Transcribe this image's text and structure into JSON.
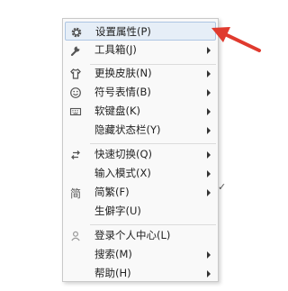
{
  "menu": {
    "items": [
      {
        "label": "设置属性(P)",
        "icon": "gear-icon",
        "submenu": false,
        "highlighted": true
      },
      {
        "label": "工具箱(J)",
        "icon": "wrench-icon",
        "submenu": true
      },
      {
        "label": "更换皮肤(N)",
        "icon": "shirt-icon",
        "submenu": true
      },
      {
        "label": "符号表情(B)",
        "icon": "smiley-icon",
        "submenu": true
      },
      {
        "label": "软键盘(K)",
        "icon": "keyboard-icon",
        "submenu": true
      },
      {
        "label": "隐藏状态栏(Y)",
        "icon": "",
        "submenu": true
      },
      {
        "label": "快速切换(Q)",
        "icon": "switch-arrows-icon",
        "submenu": true
      },
      {
        "label": "输入模式(X)",
        "icon": "",
        "submenu": true
      },
      {
        "label": "简繁(F)",
        "icon": "simplified-chinese-icon",
        "icon_text": "简",
        "submenu": true
      },
      {
        "label": "生僻字(U)",
        "icon": "",
        "submenu": false
      },
      {
        "label": "登录个人中心(L)",
        "icon": "user-icon",
        "submenu": false
      },
      {
        "label": "搜索(M)",
        "icon": "",
        "submenu": true
      },
      {
        "label": "帮助(H)",
        "icon": "",
        "submenu": true
      }
    ]
  },
  "background_fragment": "✓",
  "colors": {
    "menu_bg": "#f9f9f9",
    "highlight_bg": "#e6eef7",
    "highlight_border": "#aec6e3",
    "annotation_arrow": "#e03a2e"
  }
}
